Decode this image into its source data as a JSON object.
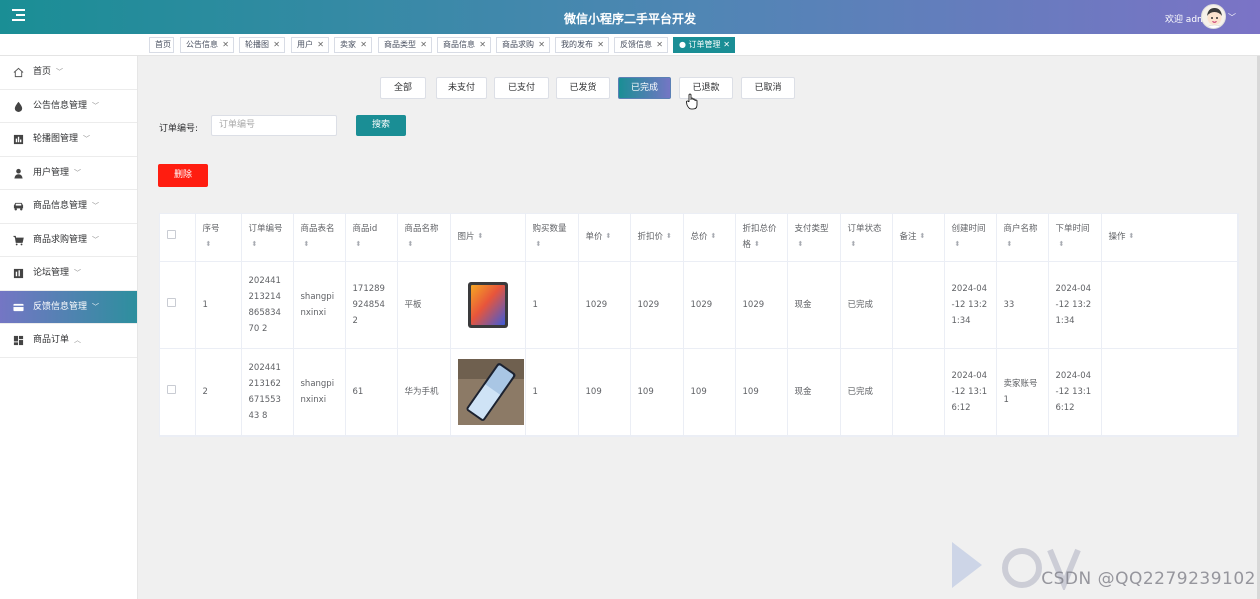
{
  "header": {
    "title": "微信小程序二手平台开发",
    "welcome": "欢迎 admin"
  },
  "tabs": [
    {
      "label": "首页",
      "closable": false
    },
    {
      "label": "公告信息",
      "closable": true
    },
    {
      "label": "轮播图",
      "closable": true
    },
    {
      "label": "用户",
      "closable": true
    },
    {
      "label": "卖家",
      "closable": true
    },
    {
      "label": "商品类型",
      "closable": true
    },
    {
      "label": "商品信息",
      "closable": true
    },
    {
      "label": "商品求购",
      "closable": true
    },
    {
      "label": "我的发布",
      "closable": true
    },
    {
      "label": "反馈信息",
      "closable": true
    },
    {
      "label": "● 订单管理",
      "closable": true,
      "active": true
    }
  ],
  "sidebar": {
    "items": [
      {
        "label": "首页",
        "icon": "home-icon",
        "chevron": "﹀"
      },
      {
        "label": "公告信息管理",
        "icon": "drop-icon",
        "chevron": "﹀"
      },
      {
        "label": "轮播图管理",
        "icon": "chart-icon",
        "chevron": "﹀"
      },
      {
        "label": "用户管理",
        "icon": "user-icon",
        "chevron": "﹀"
      },
      {
        "label": "商品信息管理",
        "icon": "car-icon",
        "chevron": "﹀"
      },
      {
        "label": "商品求购管理",
        "icon": "cart-icon",
        "chevron": "﹀"
      },
      {
        "label": "论坛管理",
        "icon": "forum-icon",
        "chevron": "﹀"
      },
      {
        "label": "反馈信息管理",
        "icon": "card-icon",
        "chevron": "﹀",
        "active": true
      },
      {
        "label": "商品订单",
        "icon": "grid-icon",
        "chevron": "︿"
      }
    ]
  },
  "status_filters": [
    "全部",
    "未支付",
    "已支付",
    "已发货",
    "已完成",
    "已退款",
    "已取消"
  ],
  "active_status": "已完成",
  "search": {
    "label": "订单编号:",
    "placeholder": "订单编号",
    "button": "搜索"
  },
  "delete_button": "删除",
  "table": {
    "headers": [
      "序号",
      "订单编号",
      "商品表名",
      "商品id",
      "商品名称",
      "图片",
      "购买数量",
      "单价",
      "折扣价",
      "总价",
      "折扣总价格",
      "支付类型",
      "订单状态",
      "备注",
      "创建时间",
      "商户名称",
      "下单时间",
      "操作"
    ],
    "rows": [
      {
        "index": "1",
        "order_no": "20244121321486583470 2",
        "table_name": "shangpinxinxi",
        "goods_id": "1712899248542",
        "goods_name": "平板",
        "image": "tablet-image",
        "qty": "1",
        "price": "1029",
        "discount_price": "1029",
        "total": "1029",
        "discount_total": "1029",
        "pay_type": "现金",
        "status": "已完成",
        "remark": "",
        "created": "2024-04-12 13:21:34",
        "merchant": "33",
        "order_time": "2024-04-12 13:21:34"
      },
      {
        "index": "2",
        "order_no": "20244121316267155343 8",
        "table_name": "shangpinxinxi",
        "goods_id": "61",
        "goods_name": "华为手机",
        "image": "phone-image",
        "qty": "1",
        "price": "109",
        "discount_price": "109",
        "total": "109",
        "discount_total": "109",
        "pay_type": "现金",
        "status": "已完成",
        "remark": "",
        "created": "2024-04-12 13:16:12",
        "merchant": "卖家账号1",
        "order_time": "2024-04-12 13:16:12"
      }
    ]
  },
  "watermark": "CSDN @QQ2279239102",
  "colors": {
    "header_start": "#1a8e95",
    "header_end": "#7b73c6",
    "accent": "#1a8e95",
    "danger": "#ff1d10"
  }
}
